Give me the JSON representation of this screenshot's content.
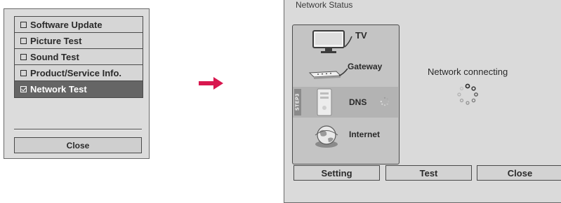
{
  "menu": {
    "items": [
      {
        "label": "Software Update",
        "checked": false,
        "selected": false
      },
      {
        "label": "Picture Test",
        "checked": false,
        "selected": false
      },
      {
        "label": "Sound Test",
        "checked": false,
        "selected": false
      },
      {
        "label": "Product/Service Info.",
        "checked": false,
        "selected": false
      },
      {
        "label": "Network Test",
        "checked": true,
        "selected": true
      }
    ],
    "close_label": "Close"
  },
  "arrow_color": "#d8174f",
  "dialog": {
    "title": "Network Status",
    "steps": [
      {
        "label": "TV",
        "icon": "tv-icon"
      },
      {
        "label": "Gateway",
        "icon": "gateway-icon"
      },
      {
        "label": "DNS",
        "icon": "dns-server-icon",
        "tag": "STEP3",
        "active": true
      },
      {
        "label": "Internet",
        "icon": "internet-globe-icon"
      }
    ],
    "status_text": "Network connecting",
    "buttons": {
      "setting": "Setting",
      "test": "Test",
      "close": "Close"
    }
  }
}
